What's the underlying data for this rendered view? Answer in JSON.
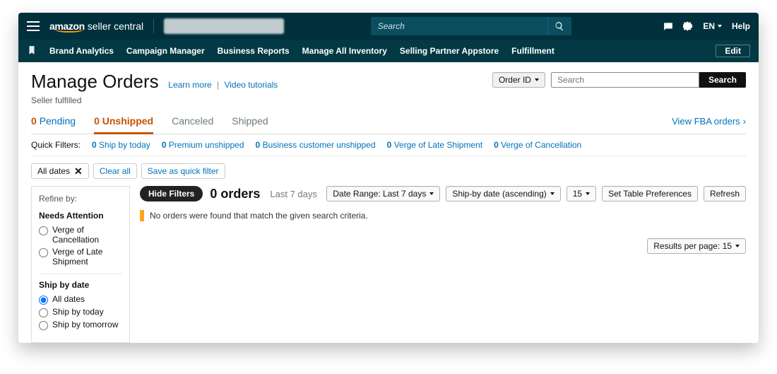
{
  "topbar": {
    "logo_main": "amazon",
    "logo_sub": "seller central",
    "search_placeholder": "Search",
    "lang": "EN",
    "help": "Help"
  },
  "nav": {
    "items": [
      "Brand Analytics",
      "Campaign Manager",
      "Business Reports",
      "Manage All Inventory",
      "Selling Partner Appstore",
      "Fulfillment"
    ],
    "edit": "Edit"
  },
  "header": {
    "title": "Manage Orders",
    "learn_more": "Learn more",
    "video_tutorials": "Video tutorials",
    "subtitle": "Seller fulfilled",
    "order_id_dd": "Order ID",
    "search_placeholder": "Search",
    "search_btn": "Search"
  },
  "tabs": {
    "items": [
      {
        "count": "0",
        "label": "Pending",
        "state": "link"
      },
      {
        "count": "0",
        "label": "Unshipped",
        "state": "active"
      },
      {
        "count": "",
        "label": "Canceled",
        "state": "inactive"
      },
      {
        "count": "",
        "label": "Shipped",
        "state": "inactive"
      }
    ],
    "fba_link": "View FBA orders"
  },
  "quick_filters": {
    "label": "Quick Filters:",
    "items": [
      {
        "n": "0",
        "label": "Ship by today"
      },
      {
        "n": "0",
        "label": "Premium unshipped"
      },
      {
        "n": "0",
        "label": "Business customer unshipped"
      },
      {
        "n": "0",
        "label": "Verge of Late Shipment"
      },
      {
        "n": "0",
        "label": "Verge of Cancellation"
      }
    ]
  },
  "chips": {
    "all_dates": "All dates",
    "clear_all": "Clear all",
    "save": "Save as quick filter"
  },
  "sidebar": {
    "refine": "Refine by:",
    "group1": "Needs Attention",
    "g1_items": [
      "Verge of Cancellation",
      "Verge of Late Shipment"
    ],
    "group2": "Ship by date",
    "g2_items": [
      "All dates",
      "Ship by today",
      "Ship by tomorrow"
    ]
  },
  "toolbar": {
    "hide_filters": "Hide Filters",
    "orders_count": "0 orders",
    "orders_sub": "Last 7 days",
    "date_range": "Date Range: Last 7 days",
    "sort": "Ship-by date (ascending)",
    "page_size": "15",
    "prefs": "Set Table Preferences",
    "refresh": "Refresh"
  },
  "message": "No orders were found that match the given search criteria.",
  "results_dd": "Results per page: 15"
}
